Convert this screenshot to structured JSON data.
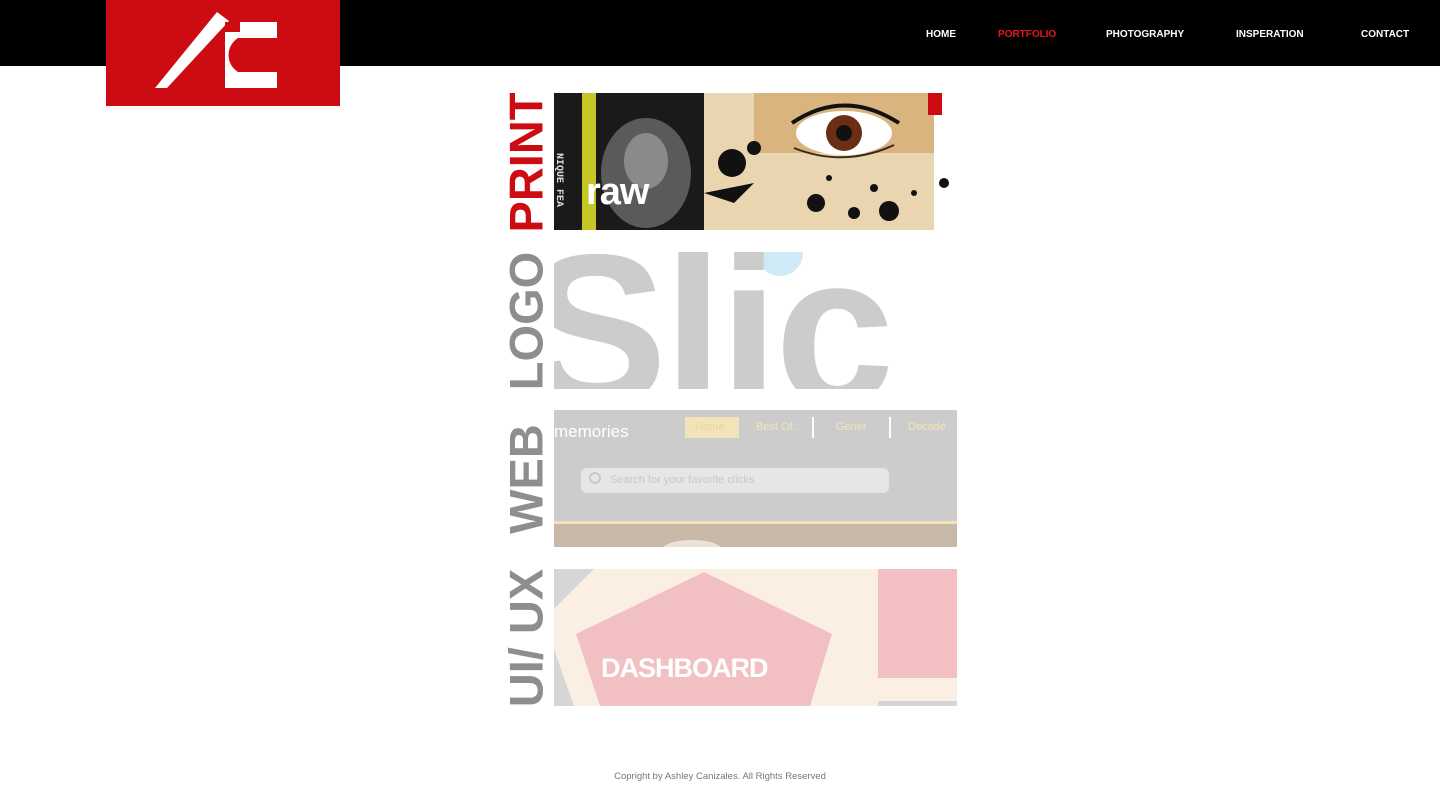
{
  "site": {
    "logo_text": "AC",
    "brand_color": "#cc0c12"
  },
  "nav": {
    "items": [
      {
        "label": "HOME",
        "active": false
      },
      {
        "label": "PORTFOLIO",
        "active": true
      },
      {
        "label": "PHOTOGRAPHY",
        "active": false
      },
      {
        "label": "INSPERATION",
        "active": false
      },
      {
        "label": "CONTACT",
        "active": false
      }
    ],
    "active_color": "#e8141c"
  },
  "portfolio": {
    "categories": [
      {
        "label": "PRINT",
        "label_color": "#cc0c12",
        "thumb": {
          "text": "raw",
          "side_text": "NIQUE FEA"
        }
      },
      {
        "label": "LOGO",
        "label_color": "#8e8e8e",
        "thumb": {
          "text": "Slic"
        }
      },
      {
        "label": "WEB",
        "label_color": "#8e8e8e",
        "thumb": {
          "brand_text": "memories",
          "nav": [
            "Home",
            "Best Of...",
            "Gener",
            "Decade"
          ],
          "search_placeholder": "Search for your favorite clicks"
        }
      },
      {
        "label": "UI/ UX",
        "label_color": "#8e8e8e",
        "thumb": {
          "text": "DASHBOARD"
        }
      }
    ]
  },
  "footer": {
    "copyright": "Copright by Ashley Canizales. All Rights Reserved"
  }
}
